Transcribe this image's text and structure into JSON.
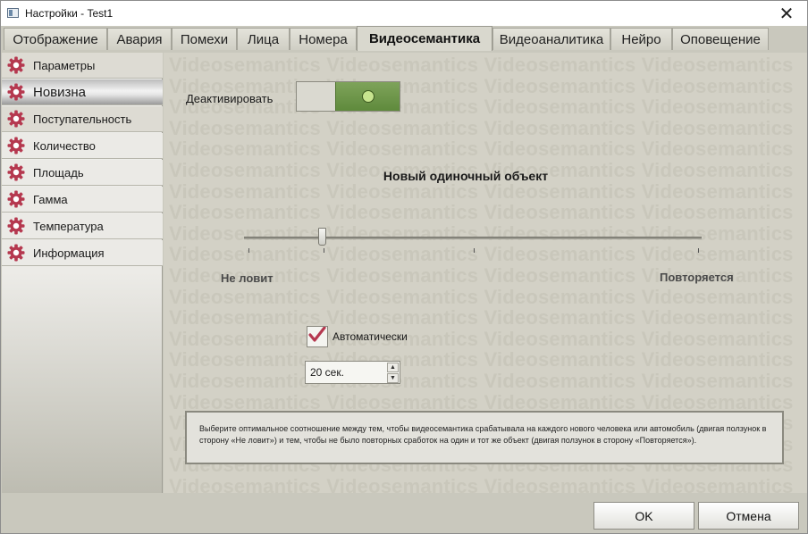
{
  "window": {
    "title": "Настройки - Test1"
  },
  "tabs": [
    {
      "label": "Отображение"
    },
    {
      "label": "Авария"
    },
    {
      "label": "Помехи"
    },
    {
      "label": "Лица"
    },
    {
      "label": "Номера"
    },
    {
      "label": "Видеосемантика",
      "active": true
    },
    {
      "label": "Видеоаналитика"
    },
    {
      "label": "Нейро"
    },
    {
      "label": "Оповещение"
    }
  ],
  "sidebar": {
    "items": [
      {
        "label": "Параметры"
      },
      {
        "label": "Новизна",
        "active": true
      },
      {
        "label": "Поступательность"
      },
      {
        "label": "Количество"
      },
      {
        "label": "Площадь"
      },
      {
        "label": "Гамма"
      },
      {
        "label": "Температура"
      },
      {
        "label": "Информация"
      }
    ]
  },
  "watermark": {
    "text": "Videosemantics"
  },
  "content": {
    "deactivate_label": "Деактивировать",
    "deactivate_toggle_on": true,
    "slider": {
      "title": "Новый одиночный объект",
      "left_label": "Не ловит",
      "right_label": "Повторяется",
      "value_fraction": 0.17
    },
    "auto": {
      "label": "Автоматически",
      "checked": true
    },
    "spinbox": {
      "value": "20 сек."
    },
    "help_text": "Выберите оптимальное соотношение между тем, чтобы видеосемантика срабатывала на каждого нового человека или автомобиль (двигая ползунок в сторону «Не ловит») и тем, чтобы не было повторных сработок на один и тот же объект (двигая ползунок в сторону «Повторяется»)."
  },
  "buttons": {
    "ok": "OK",
    "cancel": "Отмена"
  },
  "colors": {
    "icon_accent": "#b5384f",
    "toggle_on": "#6c9447"
  }
}
